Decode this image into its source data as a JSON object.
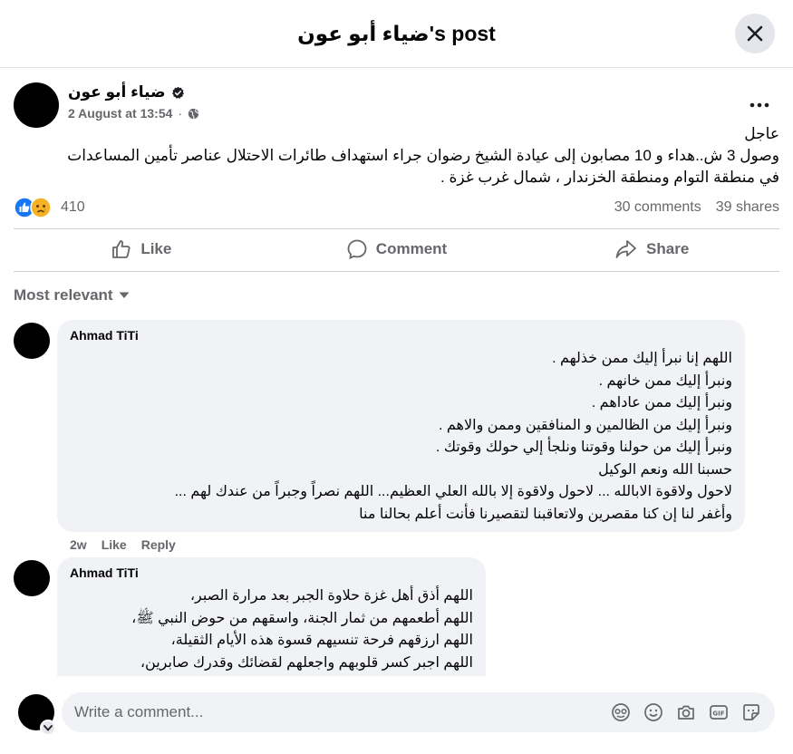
{
  "header": {
    "title": "ضياء أبو عون's post"
  },
  "post": {
    "author": "ضياء أبو عون",
    "timestamp": "2 August at 13:54",
    "text_lines": [
      "عاجل",
      "وصول 3 ش..هداء و 10 مصابون إلى عيادة الشيخ رضوان جراء استهداف طائرات الاحتلال عناصر تأمين المساعدات",
      "في منطقة التوام ومنطقة الخزندار ، شمال غرب غزة ."
    ],
    "reaction_count": "410",
    "comments_count": "30 comments",
    "shares_count": "39 shares"
  },
  "actions": {
    "like": "Like",
    "comment": "Comment",
    "share": "Share"
  },
  "sort_label": "Most relevant",
  "comments": [
    {
      "author": "Ahmad TiTi",
      "lines": [
        "اللهم إنا نبرأ إليك ممن خذلهم .",
        "ونبرأ إليك ممن خانهم .",
        "ونبرأ إليك ممن عاداهم .",
        "ونبرأ إليك من الظالمين و المنافقين وممن والاهم .",
        "ونبرأ إليك من حولنا وقوتنا ونلجأ إلي حولك وقوتك .",
        "حسبنا الله ونعم الوكيل",
        "لاحول ولاقوة الابالله ... لاحول ولاقوة إلا بالله العلي العظيم... اللهم نصراً وجبراً من عندك لهم ...",
        "وأغفر لنا إن كنا مقصرين ولاتعاقبنا لتقصيرنا فأنت أعلم بحالنا منا"
      ],
      "time": "2w",
      "like": "Like",
      "reply": "Reply"
    },
    {
      "author": "Ahmad TiTi",
      "lines": [
        "اللهم أذق أهل غزة حلاوة الجبر بعد مرارة الصبر،",
        "اللهم أطعمهم من ثمار الجنة، واسقهم من حوض النبي ﷺ،",
        "اللهم ارزقهم فرحة تنسيهم قسوة هذه الأيام الثقيلة،",
        "اللهم اجبر كسر قلوبهم واجعلهم لقضائك وقدرك صابرين،"
      ]
    }
  ],
  "composer": {
    "placeholder": "Write a comment..."
  },
  "colors": {
    "like_blue": "#1877f2",
    "sad_yellow": "#f7b125",
    "muted": "#65676b",
    "bubble": "#f0f2f5"
  },
  "icons": [
    "close-icon",
    "verified-icon",
    "globe-icon",
    "more-icon",
    "like-icon",
    "sad-icon",
    "thumbs-up-icon",
    "comment-icon",
    "share-icon",
    "caret-down-icon",
    "chevron-down-icon",
    "avatar-sticker-icon",
    "emoji-icon",
    "camera-icon",
    "gif-icon",
    "sticker-icon"
  ]
}
